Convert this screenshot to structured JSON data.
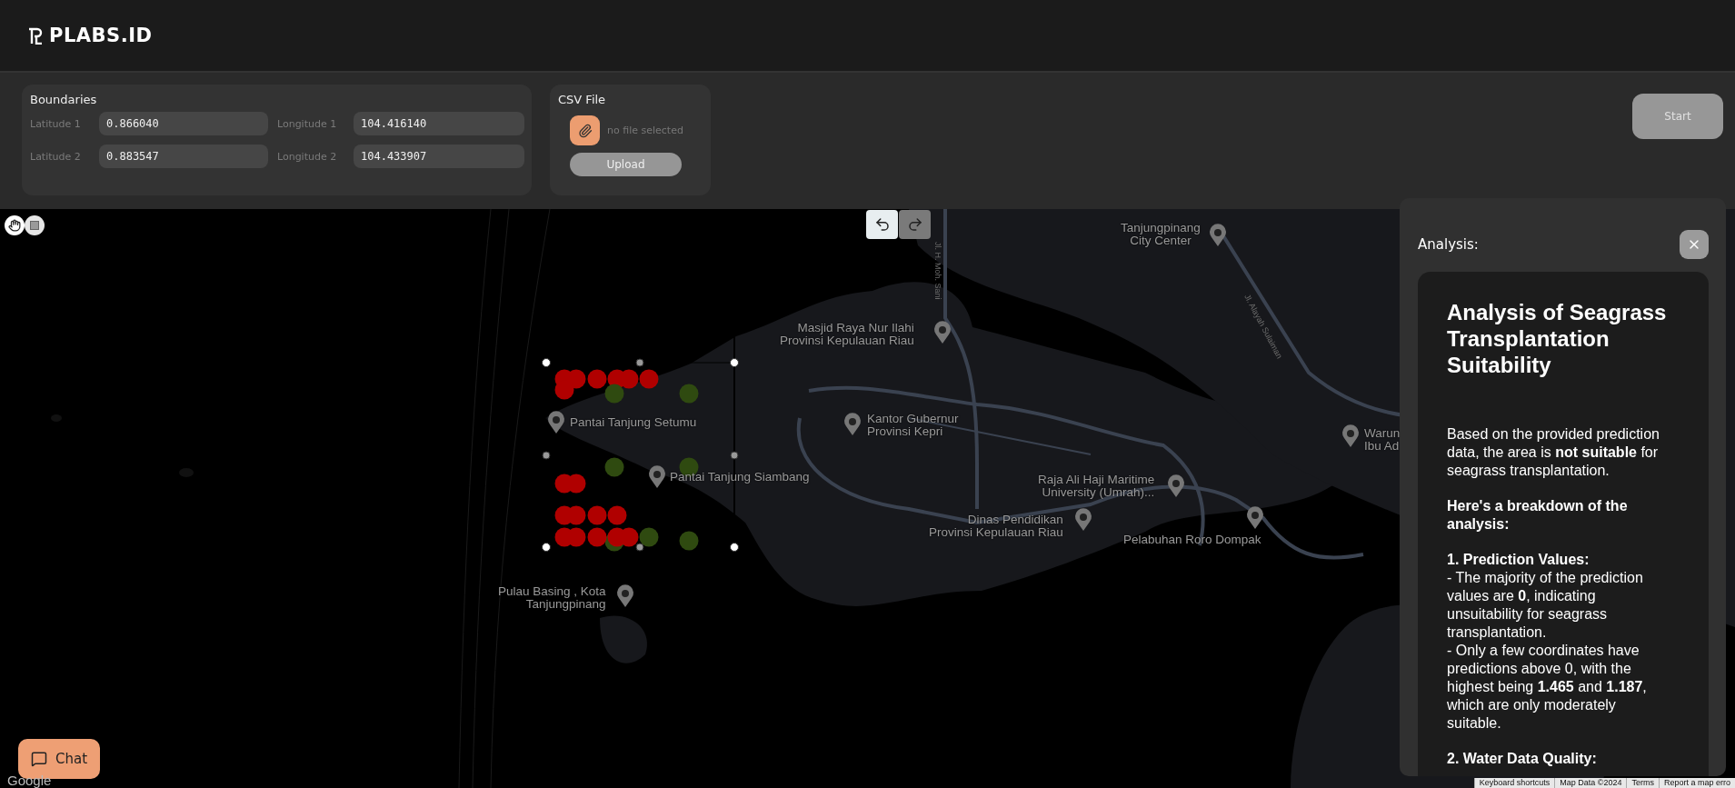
{
  "header": {
    "brand": "PLABS.ID"
  },
  "boundaries": {
    "title": "Boundaries",
    "fields": [
      {
        "label": "Latitude 1",
        "value": "0.866040"
      },
      {
        "label": "Longitude 1",
        "value": "104.416140"
      },
      {
        "label": "Latitude 2",
        "value": "0.883547"
      },
      {
        "label": "Longitude 2",
        "value": "104.433907"
      }
    ]
  },
  "csv": {
    "title": "CSV File",
    "status": "no file selected",
    "upload": "Upload"
  },
  "start_button": {
    "label": "Start",
    "disabled": true
  },
  "map": {
    "tools": [
      {
        "kind": "hand",
        "selected": true
      },
      {
        "kind": "rectangle",
        "selected": false
      }
    ],
    "history": [
      {
        "kind": "undo",
        "disabled": false
      },
      {
        "kind": "redo",
        "disabled": true
      }
    ],
    "labels": [
      {
        "lines": [
          "Tanjungpinang",
          "City Center"
        ]
      },
      {
        "lines": [
          "Masjid Raya Nur Ilahi",
          "Provinsi Kepulauan Riau"
        ]
      },
      {
        "lines": [
          "Pantai Tanjung Setumu"
        ]
      },
      {
        "lines": [
          "Kantor Gubernur",
          "Provinsi Kepri"
        ]
      },
      {
        "lines": [
          "Pantai Tanjung Siambang"
        ]
      },
      {
        "lines": [
          "Raja Ali Haji Maritime",
          "University (Umrah)..."
        ]
      },
      {
        "lines": [
          "Warun",
          "Ibu Ad"
        ]
      },
      {
        "lines": [
          "Dinas Pendidikan",
          "Provinsi Kepulauan Riau"
        ]
      },
      {
        "lines": [
          "Pelabuhan Roro Dompak"
        ]
      },
      {
        "lines": [
          "Pulau Basing , Kota",
          "Tanjungpinang"
        ]
      }
    ],
    "roads": [
      "Jl. H. Moh. Sani",
      "Jl. Alayah Sulaiman"
    ],
    "markers": [
      {
        "color": "#b00000"
      },
      {
        "color": "#b00000"
      },
      {
        "color": "#b00000"
      },
      {
        "color": "#b00000"
      },
      {
        "color": "#b00000"
      },
      {
        "color": "#b00000"
      },
      {
        "color": "#b00000"
      },
      {
        "color": "#2f4a10"
      },
      {
        "color": "#2f4a10"
      },
      {
        "color": "#2f4a10"
      },
      {
        "color": "#2f4a10"
      },
      {
        "color": "#b00000"
      },
      {
        "color": "#b00000"
      },
      {
        "color": "#b00000"
      },
      {
        "color": "#b00000"
      },
      {
        "color": "#b00000"
      },
      {
        "color": "#b00000"
      },
      {
        "color": "#2f4a10"
      },
      {
        "color": "#2f4a10"
      },
      {
        "color": "#2f4a10"
      },
      {
        "color": "#b00000"
      },
      {
        "color": "#b00000"
      },
      {
        "color": "#b00000"
      },
      {
        "color": "#b00000"
      },
      {
        "color": "#b00000"
      }
    ],
    "google": "Google",
    "attribution": [
      "Keyboard shortcuts",
      "Map Data ©2024",
      "Terms",
      "Report a map erro"
    ]
  },
  "chat_button": {
    "label": "Chat"
  },
  "analysis": {
    "title": "Analysis:",
    "heading": "Analysis of Seagrass Transplantation Suitability",
    "intro": "Based on the provided prediction data, the area is **not suitable** for seagrass transplantation.",
    "breakdown": "Here's a breakdown of the analysis:",
    "sections": [
      {
        "title": "1. Prediction Values:",
        "lines": [
          "- The majority of the prediction values are **0**, indicating unsuitability for seagrass transplantation.",
          "- Only a few coordinates have predictions above 0, with the highest being **1.465** and **1.187**, which are only moderately suitable."
        ]
      },
      {
        "title": "2. Water Data Quality:"
      }
    ]
  }
}
